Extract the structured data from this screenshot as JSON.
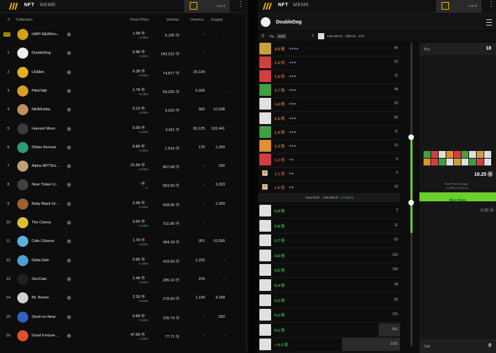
{
  "left": {
    "tabs": [
      "NFT",
      "MEME"
    ],
    "wallet_balance": "0.46 Ⓝ",
    "headers": {
      "rank": "#",
      "collection": "Collection",
      "floor": "Floor Price",
      "volume": "Volume",
      "owners": "Owners",
      "supply": "Supply"
    },
    "rows": [
      {
        "rank": "NEW",
        "name": "HAPI NEARon...",
        "floor": "1.09 Ⓝ",
        "change": "+0.00%",
        "volume": "5,105 Ⓝ",
        "owners": "-",
        "supply": "-",
        "color": "#d4a017"
      },
      {
        "rank": "1",
        "name": "DoubleDog",
        "floor": "0.96 Ⓝ",
        "change": "+0.00%",
        "volume": "183,312 Ⓝ",
        "owners": "-",
        "supply": "-",
        "color": "#f0f0f0"
      },
      {
        "rank": "2",
        "name": "USMen",
        "floor": "0.39 Ⓝ",
        "change": "+0.00%",
        "volume": "74,877 Ⓝ",
        "owners": "29,104",
        "supply": "-",
        "color": "#e0b020"
      },
      {
        "rank": "3",
        "name": "PitchTalk",
        "floor": "1.74 Ⓝ",
        "change": "+5.45%",
        "volume": "59,025 Ⓝ",
        "owners": "5,926",
        "supply": "-",
        "color": "#d8a020"
      },
      {
        "rank": "4",
        "name": "NEARvidia",
        "floor": "0.13 Ⓝ",
        "change": "+0.00%",
        "volume": "9,915 Ⓝ",
        "owners": "583",
        "supply": "10,538",
        "color": "#c09060"
      },
      {
        "rank": "5",
        "name": "Harvest Moon",
        "floor": "0.09 Ⓝ",
        "change": "+0.00%",
        "volume": "3,411 Ⓝ",
        "owners": "80,125",
        "supply": "102,441",
        "color": "#3a3a3a"
      },
      {
        "rank": "6",
        "name": "Shitzu Revival",
        "floor": "6.80 Ⓝ",
        "change": "+0.00%",
        "volume": "1,514 Ⓝ",
        "owners": "176",
        "supply": "1,000",
        "color": "#2aa070"
      },
      {
        "rank": "7",
        "name": "Alpha MITTEri...",
        "floor": "21.00 Ⓝ",
        "change": "+0.00%",
        "volume": "807.68 Ⓝ",
        "owners": "-",
        "supply": "200",
        "color": "#c0a070"
      },
      {
        "rank": "8",
        "name": "Near Tinker U...",
        "floor": "- Ⓝ",
        "change": "-%",
        "volume": "653.50 Ⓝ",
        "owners": "-",
        "supply": "3,333",
        "color": "#404040"
      },
      {
        "rank": "9",
        "name": "Baby Black Dr...",
        "floor": "2.49 Ⓝ",
        "change": "+0.00%",
        "volume": "558.66 Ⓝ",
        "owners": "-",
        "supply": "1,000",
        "color": "#a06030"
      },
      {
        "rank": "10",
        "name": "The Colony",
        "floor": "3.00 Ⓝ",
        "change": "+0.00%",
        "volume": "511.80 Ⓝ",
        "owners": "-",
        "supply": "-",
        "color": "#e0c030"
      },
      {
        "rank": "11",
        "name": "Cafe Citizens",
        "floor": "1.70 Ⓝ",
        "change": "+0.00%",
        "volume": "494.18 Ⓝ",
        "owners": "951",
        "supply": "10,000",
        "color": "#5ab0e0"
      },
      {
        "rank": "12",
        "name": "Delta Disk",
        "floor": "0.55 Ⓝ",
        "change": "+0.00%",
        "volume": "419.50 Ⓝ",
        "owners": "1,225",
        "supply": "-",
        "color": "#4aa0d0"
      },
      {
        "rank": "13",
        "name": "SiccCats",
        "floor": "1.40 Ⓝ",
        "change": "+0.00%",
        "volume": "285.10 Ⓝ",
        "owners": "224",
        "supply": "-",
        "color": "#202020"
      },
      {
        "rank": "14",
        "name": "Mr. Brown",
        "floor": "2.10 Ⓝ",
        "change": "+0.00%",
        "volume": "278.60 Ⓝ",
        "owners": "1,199",
        "supply": "4,188",
        "color": "#d0d0d0"
      },
      {
        "rank": "15",
        "name": "Slush on Near",
        "floor": "0.69 Ⓝ",
        "change": "+0.00%",
        "volume": "105.74 Ⓝ",
        "owners": "-",
        "supply": "650",
        "color": "#3060c0"
      },
      {
        "rank": "16",
        "name": "Good Fortune ...",
        "floor": "47.00 Ⓝ",
        "change": "+0.00%",
        "volume": "77.71 Ⓝ",
        "owners": "-",
        "supply": "-",
        "color": "#e05030"
      }
    ]
  },
  "right": {
    "tabs": [
      "NFT",
      "MEME"
    ],
    "wallet_balance": "0.46 Ⓝ",
    "collection_name": "DoubleDog",
    "filter_tag": "Tag",
    "filter_pct": "100%",
    "stats_text": "0.90 NEAR · Offered · 37m",
    "asks": [
      {
        "price": "2.0 Ⓝ",
        "dots": "●●●●",
        "count": "40",
        "color": "#e8903a",
        "checked": false,
        "thumb": "#c8a040"
      },
      {
        "price": "1.9 Ⓝ",
        "dots": "●●●",
        "count": "23",
        "color": "#e05a3a",
        "checked": false,
        "thumb": "#d04040"
      },
      {
        "price": "1.8 Ⓝ",
        "dots": "●●●",
        "count": "11",
        "color": "#e05a3a",
        "checked": false,
        "thumb": "#d04040"
      },
      {
        "price": "1.7 Ⓝ",
        "dots": "●●●",
        "count": "48",
        "color": "#e07a3a",
        "checked": false,
        "thumb": "#40a040"
      },
      {
        "price": "1.6 Ⓝ",
        "dots": "●●●",
        "count": "15",
        "color": "#e07a3a",
        "checked": false,
        "thumb": "#e0e0e0"
      },
      {
        "price": "1.5 Ⓝ",
        "dots": "●●●",
        "count": "55",
        "color": "#e07a3a",
        "checked": false,
        "thumb": "#e0e0e0"
      },
      {
        "price": "1.4 Ⓝ",
        "dots": "●●●",
        "count": "11",
        "color": "#e07a3a",
        "checked": false,
        "thumb": "#40a040"
      },
      {
        "price": "1.3 Ⓝ",
        "dots": "●●●",
        "count": "15",
        "color": "#e07a3a",
        "checked": false,
        "thumb": "#e09030"
      },
      {
        "price": "1.2 Ⓝ",
        "dots": "●●",
        "count": "0",
        "color": "#e05a3a",
        "checked": false,
        "thumb": "#d04040"
      },
      {
        "price": "1.1 Ⓝ",
        "dots": "●●",
        "count": "5",
        "color": "#e05a3a",
        "checked": true,
        "thumb": "#e0e0e0"
      },
      {
        "price": "1.0 Ⓝ",
        "dots": "●●",
        "count": "13",
        "color": "#e05a3a",
        "checked": true,
        "thumb": "#e0e0e0"
      }
    ],
    "now_price_label": "Now Price",
    "now_price_value": "0.96 NEAR",
    "now_price_change": "(+0.05%)",
    "bids": [
      {
        "price": "0.9 Ⓝ",
        "count": "3",
        "fill": 0
      },
      {
        "price": "0.8 Ⓝ",
        "count": "11",
        "fill": 0
      },
      {
        "price": "0.7 Ⓝ",
        "count": "62",
        "fill": 0
      },
      {
        "price": "0.6 Ⓝ",
        "count": "102",
        "fill": 0
      },
      {
        "price": "0.5 Ⓝ",
        "count": "150",
        "fill": 0
      },
      {
        "price": "0.4 Ⓝ",
        "count": "18",
        "fill": 0
      },
      {
        "price": "0.3 Ⓝ",
        "count": "62",
        "fill": 0
      },
      {
        "price": "0.2 Ⓝ",
        "count": "131",
        "fill": 0
      },
      {
        "price": "0.1 Ⓝ",
        "count": "901",
        "fill": 0.15
      },
      {
        "price": "> 0.1 Ⓝ",
        "count": "1381",
        "fill": 0.41
      }
    ],
    "buy_label": "Buy",
    "buy_count": "18",
    "buy_total": "18.25 Ⓝ",
    "floor_change_label": "Floor Price Change",
    "floor_change_value": "+0.29N (+29.61%)",
    "buy_now_label": "Buy Now",
    "sell_total": "0.00 Ⓝ",
    "sell_label": "Sell",
    "sell_count": "0"
  }
}
